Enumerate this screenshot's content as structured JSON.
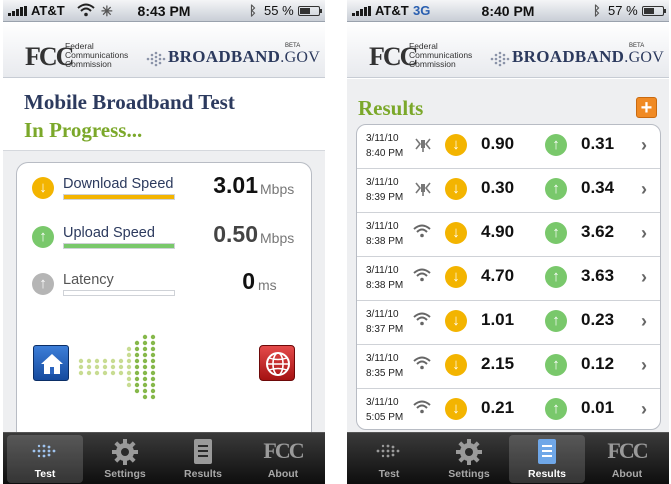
{
  "colors": {
    "navy": "#2c3a5e",
    "green": "#7ba82a",
    "download": "#f3b400",
    "upload": "#79c86b",
    "add": "#f08a24"
  },
  "header": {
    "fcc_logo": "FCC",
    "fcc_line1": "Federal",
    "fcc_line2": "Communications",
    "fcc_line3": "Commission",
    "broadband_main": "BROADBAND",
    "broadband_suffix": ".GOV",
    "beta": "BETA"
  },
  "tabs": [
    {
      "label": "Test",
      "icon": "arrow-dots-icon"
    },
    {
      "label": "Settings",
      "icon": "gear-icon"
    },
    {
      "label": "Results",
      "icon": "document-icon"
    },
    {
      "label": "About",
      "icon": "fcc-icon"
    }
  ],
  "left": {
    "status": {
      "carrier": "AT&T",
      "network_icon": "wifi-icon",
      "activity_icon": "spinner-icon",
      "time": "8:43 PM",
      "battery": "55 %",
      "battery_level": 0.55
    },
    "title_line1": "Mobile Broadband Test",
    "title_line2": "In Progress...",
    "active_tab": "Test",
    "metrics": [
      {
        "label": "Download Speed",
        "value": "3.01",
        "unit": "Mbps",
        "progress": 1.0,
        "icon": "download-arrow-icon"
      },
      {
        "label": "Upload Speed",
        "value": "0.50",
        "unit": "Mbps",
        "progress": 1.0,
        "icon": "upload-arrow-icon"
      },
      {
        "label": "Latency",
        "value": "0",
        "unit": "ms",
        "progress": 0.0,
        "icon": "latency-arrow-icon"
      }
    ],
    "home_icon": "home-icon",
    "globe_icon": "globe-icon"
  },
  "right": {
    "status": {
      "carrier": "AT&T",
      "network": "3G",
      "time": "8:40 PM",
      "battery": "57 %",
      "battery_level": 0.57
    },
    "title": "Results",
    "add_label": "+",
    "active_tab": "Results",
    "rows": [
      {
        "date": "3/11/10",
        "time": "8:40 PM",
        "connection": "cell",
        "download": "0.90",
        "upload": "0.31"
      },
      {
        "date": "3/11/10",
        "time": "8:39 PM",
        "connection": "cell",
        "download": "0.30",
        "upload": "0.34"
      },
      {
        "date": "3/11/10",
        "time": "8:38 PM",
        "connection": "wifi",
        "download": "4.90",
        "upload": "3.62"
      },
      {
        "date": "3/11/10",
        "time": "8:38 PM",
        "connection": "wifi",
        "download": "4.70",
        "upload": "3.63"
      },
      {
        "date": "3/11/10",
        "time": "8:37 PM",
        "connection": "wifi",
        "download": "1.01",
        "upload": "0.23"
      },
      {
        "date": "3/11/10",
        "time": "8:35 PM",
        "connection": "wifi",
        "download": "2.15",
        "upload": "0.12"
      },
      {
        "date": "3/11/10",
        "time": "5:05 PM",
        "connection": "wifi",
        "download": "0.21",
        "upload": "0.01"
      }
    ]
  }
}
